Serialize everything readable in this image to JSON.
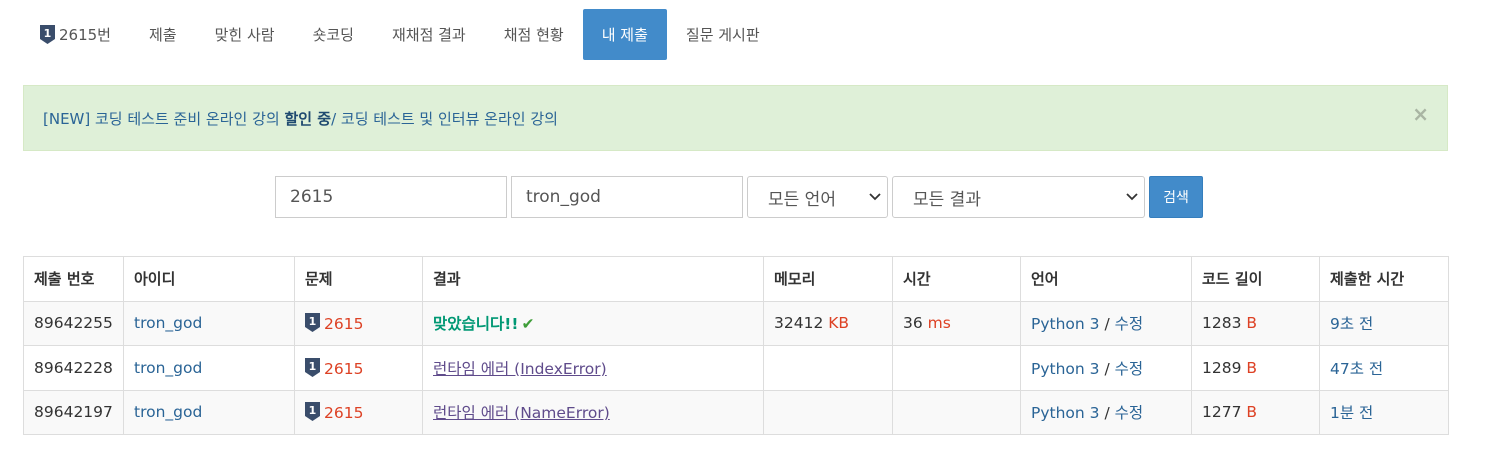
{
  "nav": {
    "items": [
      {
        "label": "2615번",
        "icon": "tier-badge-icon"
      },
      {
        "label": "제출"
      },
      {
        "label": "맞힌 사람"
      },
      {
        "label": "숏코딩"
      },
      {
        "label": "재채점 결과"
      },
      {
        "label": "채점 현황"
      },
      {
        "label": "내 제출",
        "active": true
      },
      {
        "label": "질문 게시판"
      }
    ]
  },
  "alert": {
    "prefix": "[NEW] 코딩 테스트 준비 온라인 강의 ",
    "bold": "할인 중",
    "suffix": " / 코딩 테스트 및 인터뷰 온라인 강의",
    "close": "×"
  },
  "search": {
    "problem_value": "2615",
    "user_value": "tron_god",
    "language_selected": "모든 언어",
    "result_selected": "모든 결과",
    "button_label": "검색"
  },
  "table": {
    "headers": [
      "제출 번호",
      "아이디",
      "문제",
      "결과",
      "메모리",
      "시간",
      "언어",
      "코드 길이",
      "제출한 시간"
    ],
    "rows": [
      {
        "id": "89642255",
        "user": "tron_god",
        "problem": "2615",
        "result": "맞았습니다!!",
        "result_type": "accepted",
        "memory": "32412",
        "memory_unit": "KB",
        "time": "36",
        "time_unit": "ms",
        "language": "Python 3",
        "sep": " / ",
        "edit": "수정",
        "length": "1283",
        "length_unit": "B",
        "submitted": "9초 전"
      },
      {
        "id": "89642228",
        "user": "tron_god",
        "problem": "2615",
        "result": "런타임 에러 (IndexError)",
        "result_type": "runtime-error",
        "memory": "",
        "memory_unit": "",
        "time": "",
        "time_unit": "",
        "language": "Python 3",
        "sep": " / ",
        "edit": "수정",
        "length": "1289",
        "length_unit": "B",
        "submitted": "47초 전"
      },
      {
        "id": "89642197",
        "user": "tron_god",
        "problem": "2615",
        "result": "런타임 에러 (NameError)",
        "result_type": "runtime-error",
        "memory": "",
        "memory_unit": "",
        "time": "",
        "time_unit": "",
        "language": "Python 3",
        "sep": " / ",
        "edit": "수정",
        "length": "1277",
        "length_unit": "B",
        "submitted": "1분 전"
      }
    ]
  },
  "colors": {
    "accent": "#428bca",
    "link": "#2a6496",
    "red": "#dd4124",
    "accepted": "#009874",
    "error": "#5f4b8b",
    "alert_bg": "#dff0d8"
  }
}
